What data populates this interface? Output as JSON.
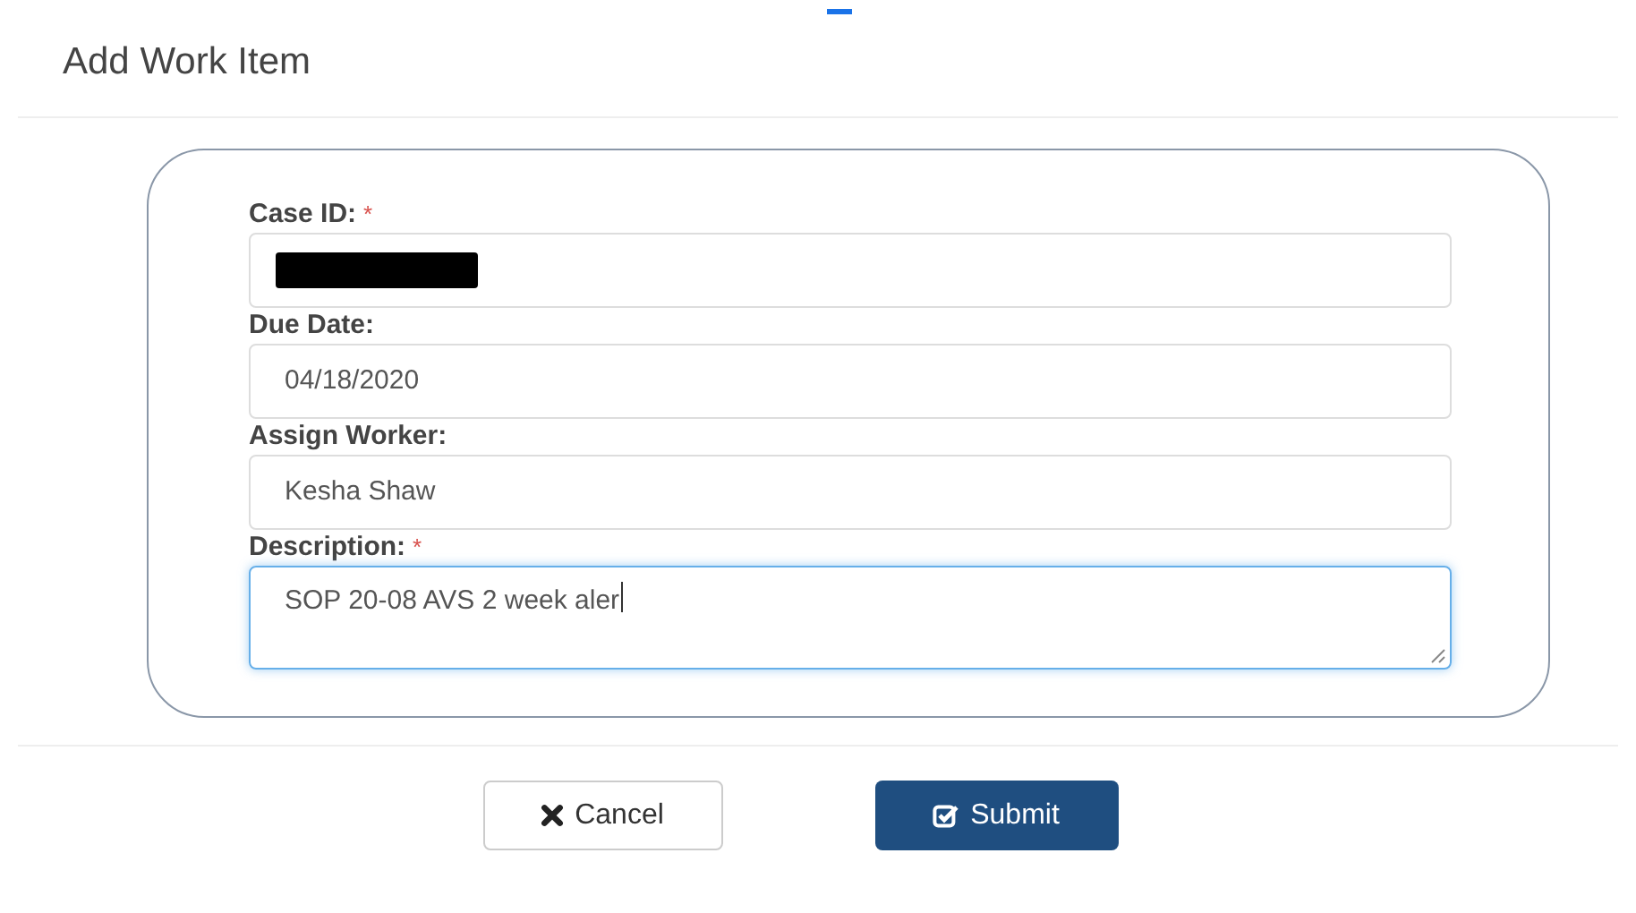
{
  "dialog": {
    "title": "Add Work Item"
  },
  "fields": [
    {
      "label": "Case ID:",
      "required_mark": "*",
      "kind": "input",
      "redacted": true,
      "focused": false
    },
    {
      "label": "Due Date:",
      "kind": "input",
      "value": "04/18/2020",
      "redacted": false,
      "focused": false
    },
    {
      "label": "Assign Worker:",
      "kind": "input",
      "value": "Kesha Shaw",
      "redacted": false,
      "focused": false
    },
    {
      "label": "Description:",
      "required_mark": "*",
      "kind": "textarea",
      "value": "SOP 20-08 AVS 2 week aler",
      "redacted": false,
      "focused": true
    }
  ],
  "buttons": [
    {
      "label": "Cancel",
      "kind": "cancel"
    },
    {
      "label": "Submit",
      "kind": "submit"
    }
  ]
}
